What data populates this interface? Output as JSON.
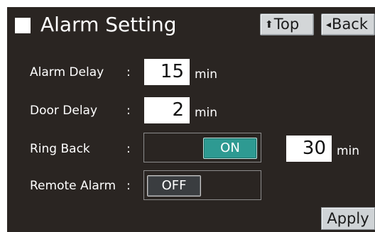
{
  "header": {
    "title": "Alarm Setting",
    "top_button": {
      "icon": "up-arrow-icon",
      "label": "Top"
    },
    "back_button": {
      "icon": "left-arrow-icon",
      "label": "Back"
    }
  },
  "settings": {
    "alarm_delay": {
      "label": "Alarm Delay",
      "colon": ":",
      "value": "15",
      "unit": "min"
    },
    "door_delay": {
      "label": "Door Delay",
      "colon": ":",
      "value": "2",
      "unit": "min"
    },
    "ring_back": {
      "label": "Ring Back",
      "colon": ":",
      "toggle": "ON",
      "value": "30",
      "unit": "min"
    },
    "remote_alarm": {
      "label": "Remote Alarm",
      "colon": ":",
      "toggle": "OFF"
    }
  },
  "footer": {
    "apply_label": "Apply"
  },
  "colors": {
    "panel_background": "#2a2522",
    "toggle_on": "#2e9a92",
    "toggle_off": "#3a3d40",
    "button_face": "#d3d6d8"
  }
}
